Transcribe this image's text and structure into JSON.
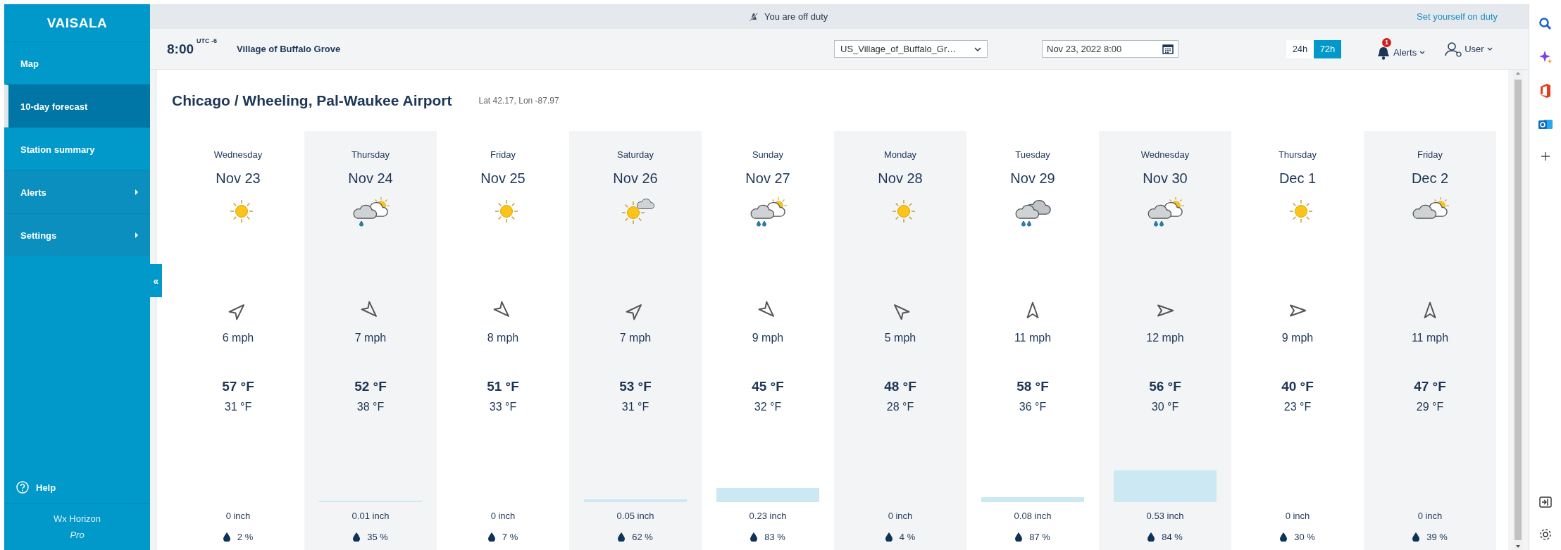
{
  "sidebar": {
    "logo": "VAISALA",
    "items": [
      {
        "label": "Map",
        "selected": false,
        "expandable": false
      },
      {
        "label": "10-day forecast",
        "selected": true,
        "expandable": false
      },
      {
        "label": "Station summary",
        "selected": false,
        "expandable": false
      },
      {
        "label": "Alerts",
        "selected": false,
        "expandable": true
      },
      {
        "label": "Settings",
        "selected": false,
        "expandable": true
      }
    ],
    "help": "Help",
    "product": "Wx Horizon",
    "edition": "Pro",
    "collapse": "«"
  },
  "duty_bar": {
    "status": "You are off duty",
    "action": "Set yourself on duty"
  },
  "toolbar": {
    "time": "8:00",
    "timezone": "UTC -6",
    "location": "Village of Buffalo Grove",
    "station_select": "US_Village_of_Buffalo_Gr…",
    "datetime": "Nov 23, 2022 8:00",
    "ranges": [
      {
        "label": "24h",
        "selected": false
      },
      {
        "label": "72h",
        "selected": true
      }
    ],
    "alerts": {
      "label": "Alerts",
      "count": "1"
    },
    "user": "User"
  },
  "station": {
    "name": "Chicago / Wheeling, Pal-Waukee Airport",
    "coords": "Lat 42.17, Lon -87.97"
  },
  "days": [
    {
      "weekday": "Wednesday",
      "date": "Nov 23",
      "icon": {
        "kind": "sunny"
      },
      "arrow": {
        "kind": "ne"
      },
      "wind": "6 mph",
      "high": "57 °F",
      "low": "31 °F",
      "precip": {
        "amount": "0 inch",
        "chance": "2 %"
      }
    },
    {
      "weekday": "Thursday",
      "date": "Nov 24",
      "icon": {
        "kind": "showers"
      },
      "arrow": {
        "kind": "se"
      },
      "wind": "7 mph",
      "high": "52 °F",
      "low": "38 °F",
      "precip": {
        "amount": "0.01 inch",
        "chance": "35 %"
      }
    },
    {
      "weekday": "Friday",
      "date": "Nov 25",
      "icon": {
        "kind": "sunny"
      },
      "arrow": {
        "kind": "se"
      },
      "wind": "8 mph",
      "high": "51 °F",
      "low": "33 °F",
      "precip": {
        "amount": "0 inch",
        "chance": "7 %"
      }
    },
    {
      "weekday": "Saturday",
      "date": "Nov 26",
      "icon": {
        "kind": "suncloud"
      },
      "arrow": {
        "kind": "ne"
      },
      "wind": "7 mph",
      "high": "53 °F",
      "low": "31 °F",
      "precip": {
        "amount": "0.05 inch",
        "chance": "62 %"
      }
    },
    {
      "weekday": "Sunday",
      "date": "Nov 27",
      "icon": {
        "kind": "rainsun"
      },
      "arrow": {
        "kind": "se"
      },
      "wind": "9 mph",
      "high": "45 °F",
      "low": "32 °F",
      "precip": {
        "amount": "0.23 inch",
        "chance": "83 %"
      }
    },
    {
      "weekday": "Monday",
      "date": "Nov 28",
      "icon": {
        "kind": "sunny"
      },
      "arrow": {
        "kind": "nw"
      },
      "wind": "5 mph",
      "high": "48 °F",
      "low": "28 °F",
      "precip": {
        "amount": "0 inch",
        "chance": "4 %"
      }
    },
    {
      "weekday": "Tuesday",
      "date": "Nov 29",
      "icon": {
        "kind": "rain"
      },
      "arrow": {
        "kind": "n"
      },
      "wind": "11 mph",
      "high": "58 °F",
      "low": "36 °F",
      "precip": {
        "amount": "0.08 inch",
        "chance": "87 %"
      }
    },
    {
      "weekday": "Wednesday",
      "date": "Nov 30",
      "icon": {
        "kind": "rainsun"
      },
      "arrow": {
        "kind": "e"
      },
      "wind": "12 mph",
      "high": "56 °F",
      "low": "30 °F",
      "precip": {
        "amount": "0.53 inch",
        "chance": "84 %"
      }
    },
    {
      "weekday": "Thursday",
      "date": "Dec 1",
      "icon": {
        "kind": "sunny"
      },
      "arrow": {
        "kind": "e"
      },
      "wind": "9 mph",
      "high": "40 °F",
      "low": "23 °F",
      "precip": {
        "amount": "0 inch",
        "chance": "30 %"
      }
    },
    {
      "weekday": "Friday",
      "date": "Dec 2",
      "icon": {
        "kind": "cloudsun"
      },
      "arrow": {
        "kind": "n"
      },
      "wind": "11 mph",
      "high": "47 °F",
      "low": "29 °F",
      "precip": {
        "amount": "0 inch",
        "chance": "39 %"
      }
    }
  ]
}
